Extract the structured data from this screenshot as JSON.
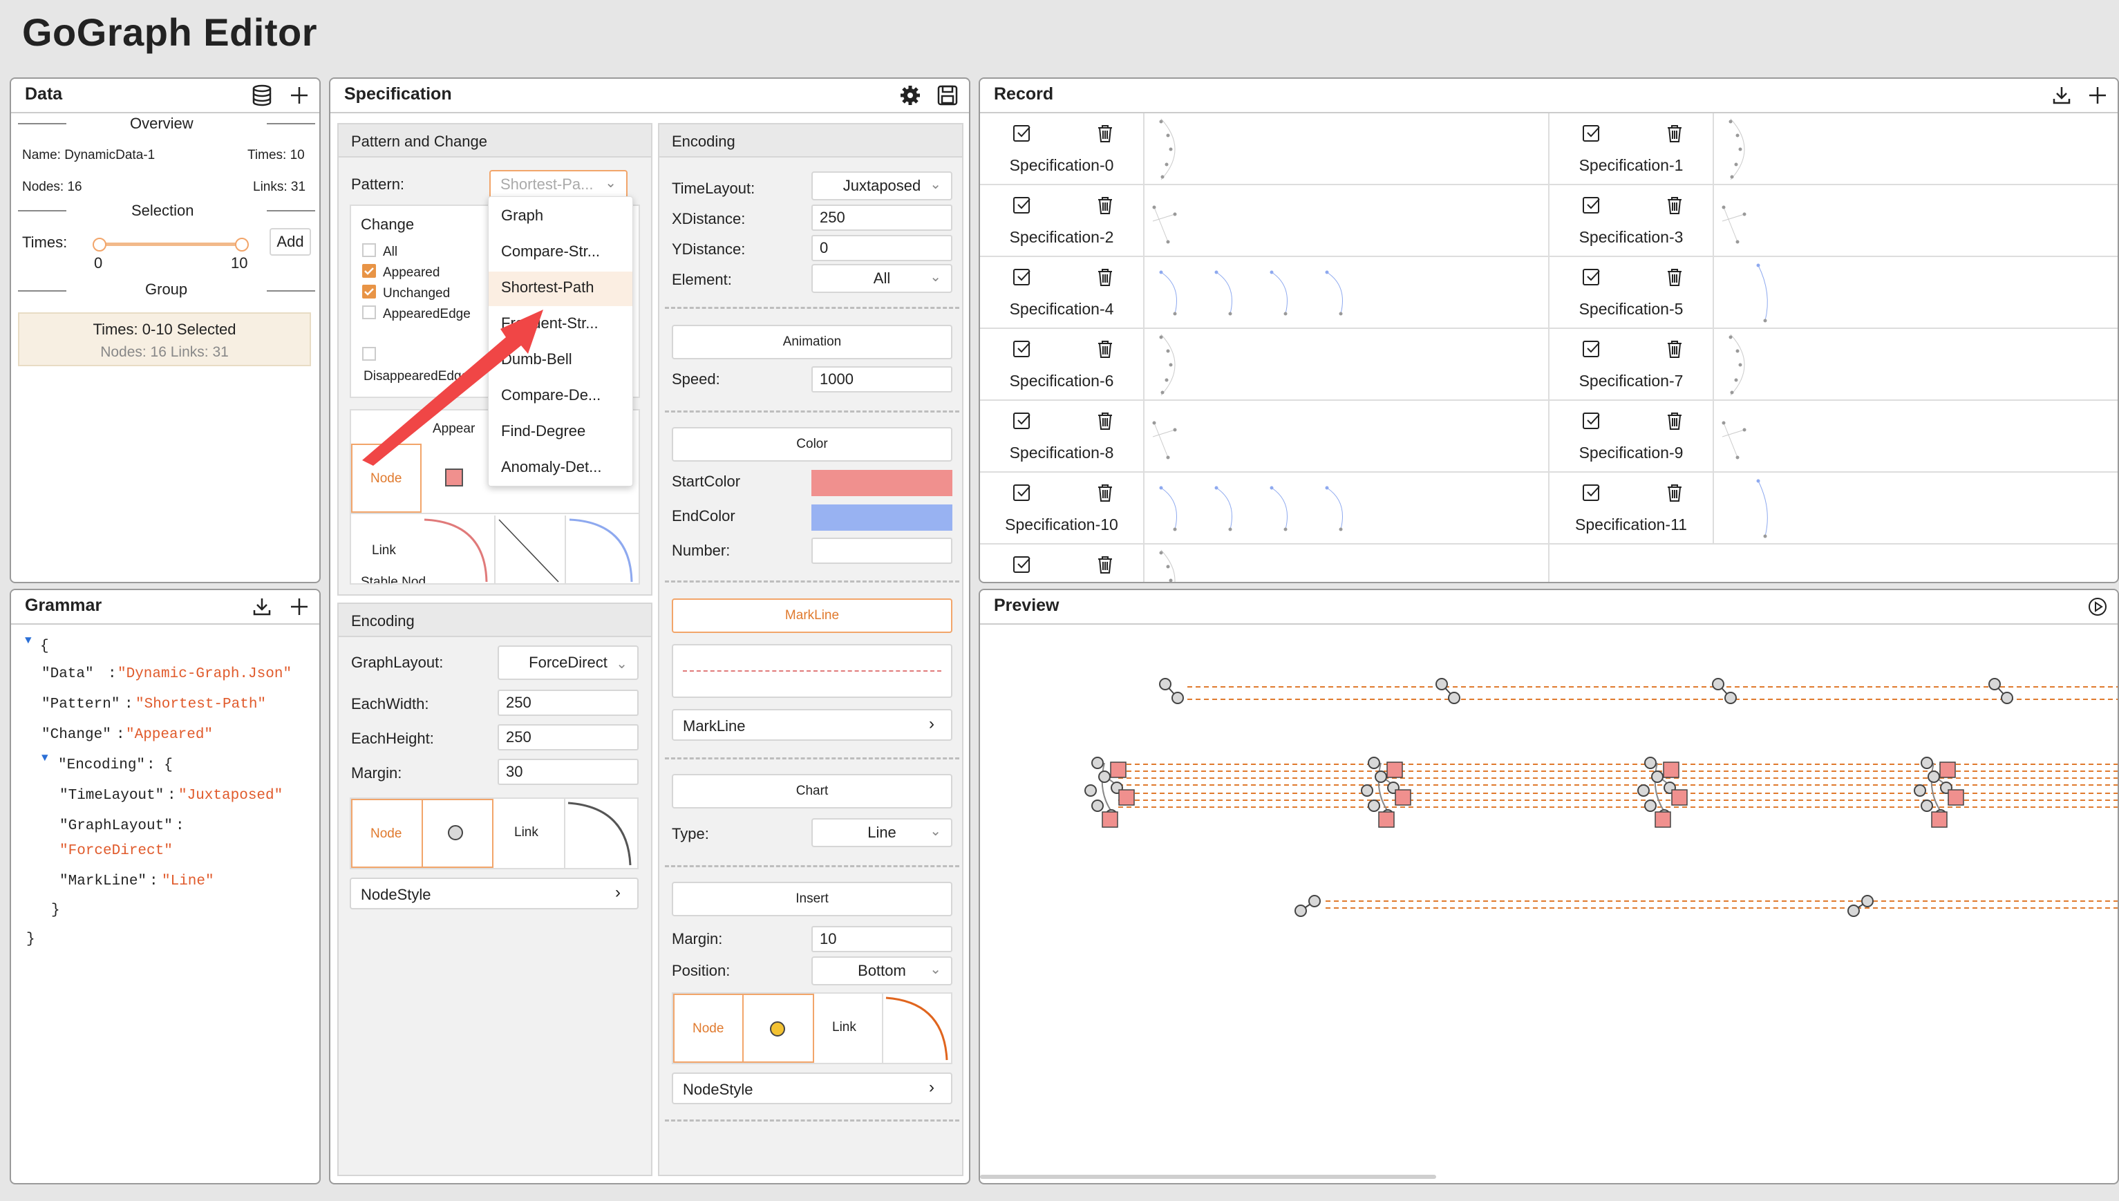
{
  "app": {
    "title": "GoGraph Editor"
  },
  "data_panel": {
    "title": "Data",
    "overview": "Overview",
    "name": "Name: DynamicData-1",
    "times": "Times: 10",
    "nodes": "Nodes: 16",
    "links": "Links: 31",
    "selection": "Selection",
    "times_label": "Times:",
    "slider_min": "0",
    "slider_max": "10",
    "slider_range": [
      0,
      10
    ],
    "add_label": "Add",
    "group": "Group",
    "group_item_title": "Times: 0-10 Selected",
    "group_item_sub": "Nodes: 16 Links: 31"
  },
  "grammar_panel": {
    "title": "Grammar",
    "open_brace": "{",
    "close_brace": "}",
    "data_key": "\"Data\"",
    "data_val": "\"Dynamic-Graph.Json\"",
    "pattern_key": "\"Pattern\"",
    "pattern_val": "\"Shortest-Path\"",
    "change_key": "\"Change\"",
    "change_val": "\"Appeared\"",
    "encoding_key": "\"Encoding\"",
    "encoding_open": ": {",
    "timelayout_key": "\"TimeLayout\"",
    "timelayout_val": "\"Juxtaposed\"",
    "graphlayout_key": "\"GraphLayout\"",
    "graphlayout_val": "\"ForceDirect\"",
    "markline_key": "\"MarkLine\"",
    "markline_val": "\"Line\"",
    "inner_close": "}",
    "colon": ":"
  },
  "spec_panel": {
    "title": "Specification",
    "pattern_change": {
      "header": "Pattern and Change",
      "pattern_label": "Pattern:",
      "pattern_value": "Shortest-Pa...",
      "change_header": "Change",
      "checks": [
        {
          "label": "All",
          "checked": false
        },
        {
          "label": "Appeared",
          "checked": true
        },
        {
          "label": "Unchanged",
          "checked": true
        },
        {
          "label": "AppearedEdge",
          "checked": false
        },
        {
          "label": "DisappearedEdge",
          "checked": false
        }
      ],
      "appear_col": "Appear",
      "node_label": "Node",
      "link_label": "Link",
      "stable_partial": "Stable Nod"
    },
    "dropdown": {
      "items": [
        "Graph",
        "Compare-Str...",
        "Shortest-Path",
        "Frequent-Str...",
        "Dumb-Bell",
        "Compare-De...",
        "Find-Degree",
        "Anomaly-Det..."
      ],
      "selected_index": 2
    },
    "encoding_left": {
      "header": "Encoding",
      "graphlayout_label": "GraphLayout:",
      "graphlayout_value": "ForceDirect",
      "eachwidth_label": "EachWidth:",
      "eachwidth_value": "250",
      "eachheight_label": "EachHeight:",
      "eachheight_value": "250",
      "margin_label": "Margin:",
      "margin_value": "30",
      "node_label": "Node",
      "link_label": "Link",
      "nodestyle_label": "NodeStyle"
    },
    "encoding_right": {
      "header": "Encoding",
      "timelayout_label": "TimeLayout:",
      "timelayout_value": "Juxtaposed",
      "xdistance_label": "XDistance:",
      "xdistance_value": "250",
      "ydistance_label": "YDistance:",
      "ydistance_value": "0",
      "element_label": "Element:",
      "element_value": "All",
      "animation_header": "Animation",
      "speed_label": "Speed:",
      "speed_value": "1000",
      "color_header": "Color",
      "startcolor_label": "StartColor",
      "startcolor": "#f0908e",
      "endcolor_label": "EndColor",
      "endcolor": "#98b2f2",
      "number_label": "Number:",
      "number_value": "",
      "markline_header": "MarkLine",
      "markline_row": "MarkLine",
      "chart_header": "Chart",
      "type_label": "Type:",
      "type_value": "Line",
      "insert_header": "Insert",
      "margin_label": "Margin:",
      "margin_value": "10",
      "position_label": "Position:",
      "position_value": "Bottom",
      "node_label": "Node",
      "link_label": "Link",
      "nodestyle_label": "NodeStyle"
    }
  },
  "record_panel": {
    "title": "Record",
    "specs": [
      "Specification-0",
      "Specification-1",
      "Specification-2",
      "Specification-3",
      "Specification-4",
      "Specification-5",
      "Specification-6",
      "Specification-7",
      "Specification-8",
      "Specification-9",
      "Specification-10",
      "Specification-11"
    ]
  },
  "preview_panel": {
    "title": "Preview"
  },
  "colors": {
    "accent": "#e07a2e",
    "node_fill": "#f0908e",
    "yellow": "#f3c232",
    "blue_link": "#7e9df0"
  },
  "icons": [
    "database-icon",
    "plus-icon",
    "gear-icon",
    "save-icon",
    "download-icon",
    "checkbox-icon",
    "trash-icon",
    "play-icon",
    "chevron-right-icon",
    "chevron-down-icon",
    "arrow-annotation"
  ]
}
